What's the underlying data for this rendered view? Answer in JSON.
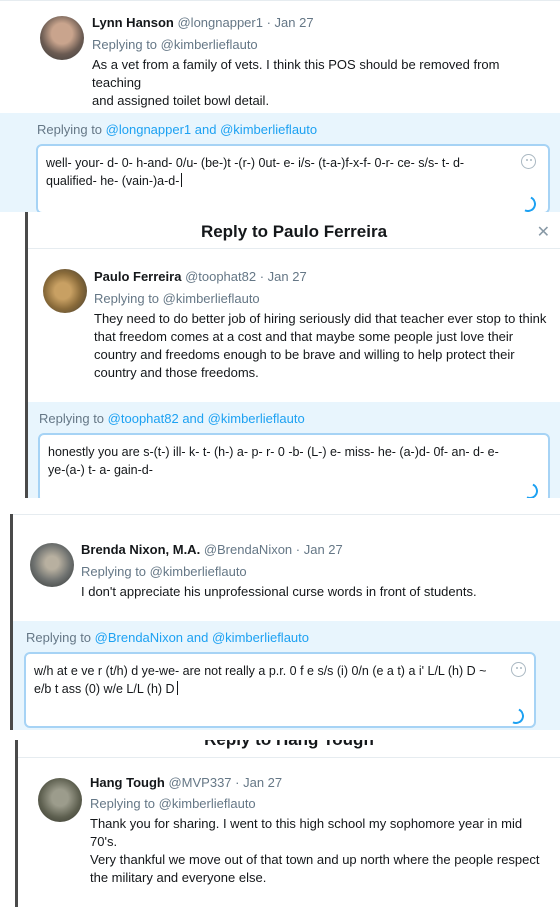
{
  "panels": [
    {
      "tweet": {
        "name": "Lynn Hanson",
        "handle": "@longnapper1",
        "date": "· Jan 27",
        "replying_to": "Replying to @kimberlieflauto",
        "lines": [
          "As a vet from a family of vets. I think this POS should be removed from teaching",
          "and assigned toilet bowl detail."
        ]
      },
      "reply": {
        "prefix": "Replying to",
        "mention1": "@longnapper1",
        "conj": "and",
        "mention2": "@kimberlieflauto",
        "lines": [
          "well- your- d- 0- h-and- 0/u- (be-)t -(r-) 0ut- e- i/s- (t-a-)f-x-f- 0-r- ce- s/s- t- d-",
          "qualified- he- (vain-)a-d-"
        ]
      }
    },
    {
      "modal_title": "Reply to Paulo Ferreira",
      "tweet": {
        "name": "Paulo Ferreira",
        "handle": "@toophat82",
        "date": "· Jan 27",
        "replying_to": "Replying to @kimberlieflauto",
        "lines": [
          "They need to do better job of hiring seriously did that teacher ever stop to think",
          "that freedom comes at a cost and that maybe some people just love their",
          "country and freedoms enough to be brave and willing to help protect their",
          "country and those freedoms."
        ]
      },
      "reply": {
        "prefix": "Replying to",
        "mention1": "@toophat82",
        "conj": "and",
        "mention2": "@kimberlieflauto",
        "lines": [
          "honestly you are s-(t-) ill- k- t- (h-) a- p- r- 0 -b- (L-) e- miss- he- (a-)d- 0f- an- d- e-",
          "ye-(a-) t- a- gain-d-"
        ]
      }
    },
    {
      "tweet": {
        "name": "Brenda Nixon, M.A.",
        "handle": "@BrendaNixon",
        "date": "· Jan 27",
        "replying_to": "Replying to @kimberlieflauto",
        "lines": [
          "I don't appreciate his unprofessional curse words in front of students."
        ]
      },
      "reply": {
        "prefix": "Replying to",
        "mention1": "@BrendaNixon",
        "conj": "and",
        "mention2": "@kimberlieflauto",
        "lines": [
          "w/h at e ve r (t/h)  d  ye-we- are not really a p.r. 0 f e s/s (i) 0/n (e a t) a i' L/L (h) D ~",
          "e/b t ass (0) w/e L/L (h) D"
        ]
      }
    },
    {
      "modal_title": "Reply to Hang Tough",
      "tweet": {
        "name": "Hang Tough",
        "handle": "@MVP337",
        "date": "· Jan 27",
        "replying_to": "Replying to @kimberlieflauto",
        "lines": [
          "Thank you for sharing. I went to this high school my sophomore year in mid",
          "70's.",
          "Very thankful we move out of that town and up north where the people respect",
          "the military and everyone else."
        ]
      }
    }
  ]
}
